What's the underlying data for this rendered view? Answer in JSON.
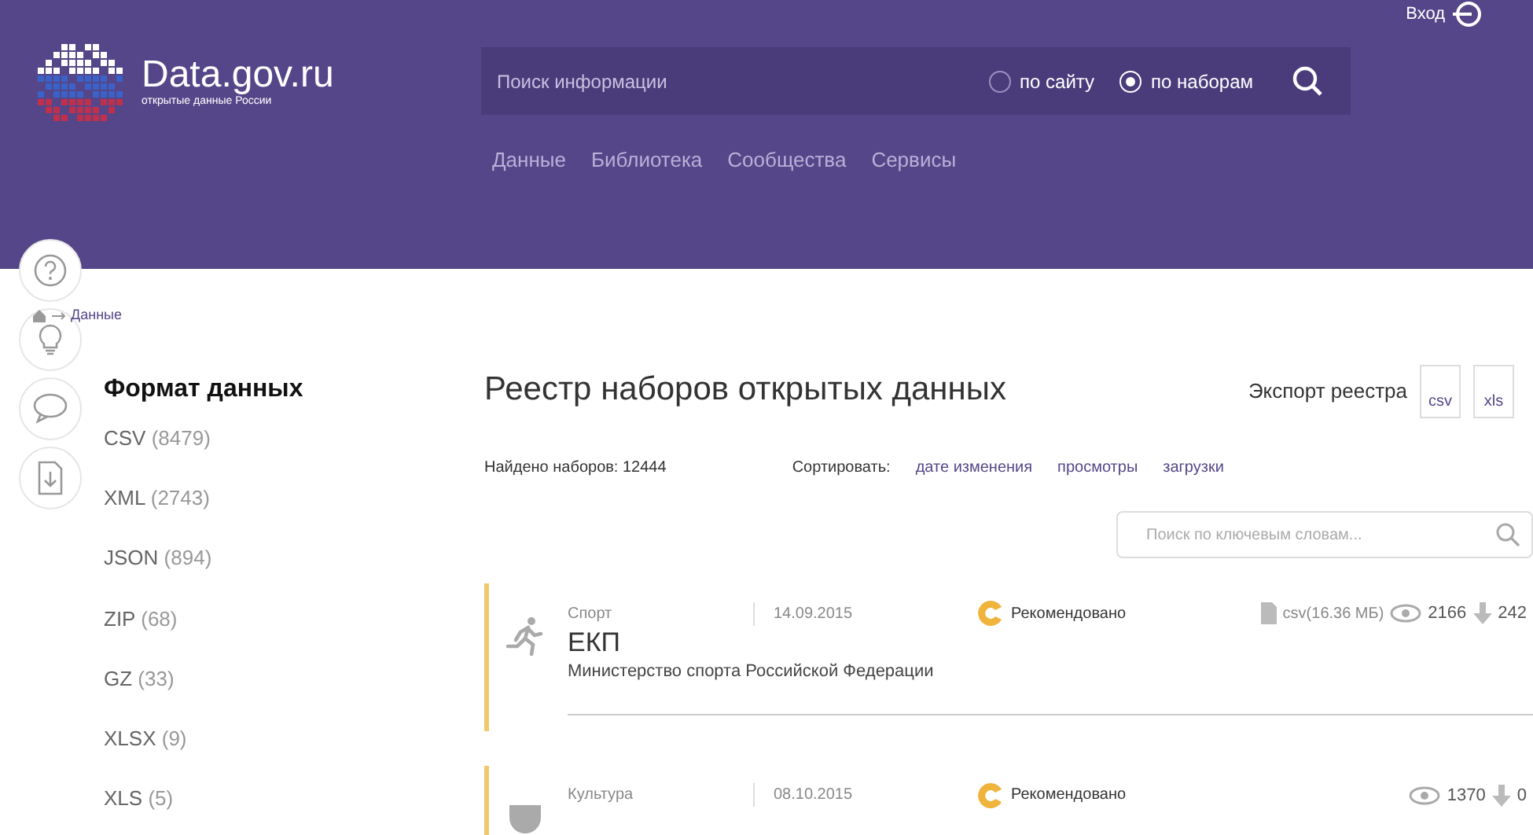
{
  "header": {
    "logo_title": "Data.gov.ru",
    "logo_subtitle": "открытые данные России",
    "login": "Вход",
    "search": {
      "placeholder": "Поиск информации",
      "scopes": [
        {
          "label": "по сайту",
          "selected": false
        },
        {
          "label": "по наборам",
          "selected": true
        }
      ]
    },
    "nav": [
      "Данные",
      "Библиотека",
      "Сообщества",
      "Сервисы"
    ]
  },
  "side_tools": [
    {
      "kind": "help"
    },
    {
      "kind": "idea"
    },
    {
      "kind": "comment"
    },
    {
      "kind": "download"
    }
  ],
  "breadcrumb": [
    "Данные"
  ],
  "filters": {
    "title": "Формат данных",
    "items": [
      {
        "label": "CSV",
        "count": "(8479)"
      },
      {
        "label": "XML",
        "count": "(2743)"
      },
      {
        "label": "JSON",
        "count": "(894)"
      },
      {
        "label": "ZIP",
        "count": "(68)"
      },
      {
        "label": "GZ",
        "count": "(33)"
      },
      {
        "label": "XLSX",
        "count": "(9)"
      },
      {
        "label": "XLS",
        "count": "(5)"
      }
    ]
  },
  "registry": {
    "title": "Реестр наборов открытых данных",
    "export_label": "Экспорт реестра",
    "export_formats": [
      "csv",
      "xls"
    ],
    "found": "Найдено наборов: 12444",
    "sort_label": "Сортировать:",
    "sort_options": [
      "дате изменения",
      "просмотры",
      "загрузки"
    ],
    "keyword_search": {
      "placeholder": "Поиск по ключевым словам..."
    },
    "datasets": [
      {
        "category": "Спорт",
        "date": "14.09.2015",
        "badge": "Рекомендовано",
        "file": "csv(16.36 МБ)",
        "views": "2166",
        "downloads": "242",
        "title": "ЕКП",
        "publisher": "Министерство спорта Российской Федерации",
        "kind": "runner"
      },
      {
        "category": "Культура",
        "date": "08.10.2015",
        "badge": "Рекомендовано",
        "views": "1370",
        "downloads": "0",
        "kind": "culture"
      }
    ]
  }
}
